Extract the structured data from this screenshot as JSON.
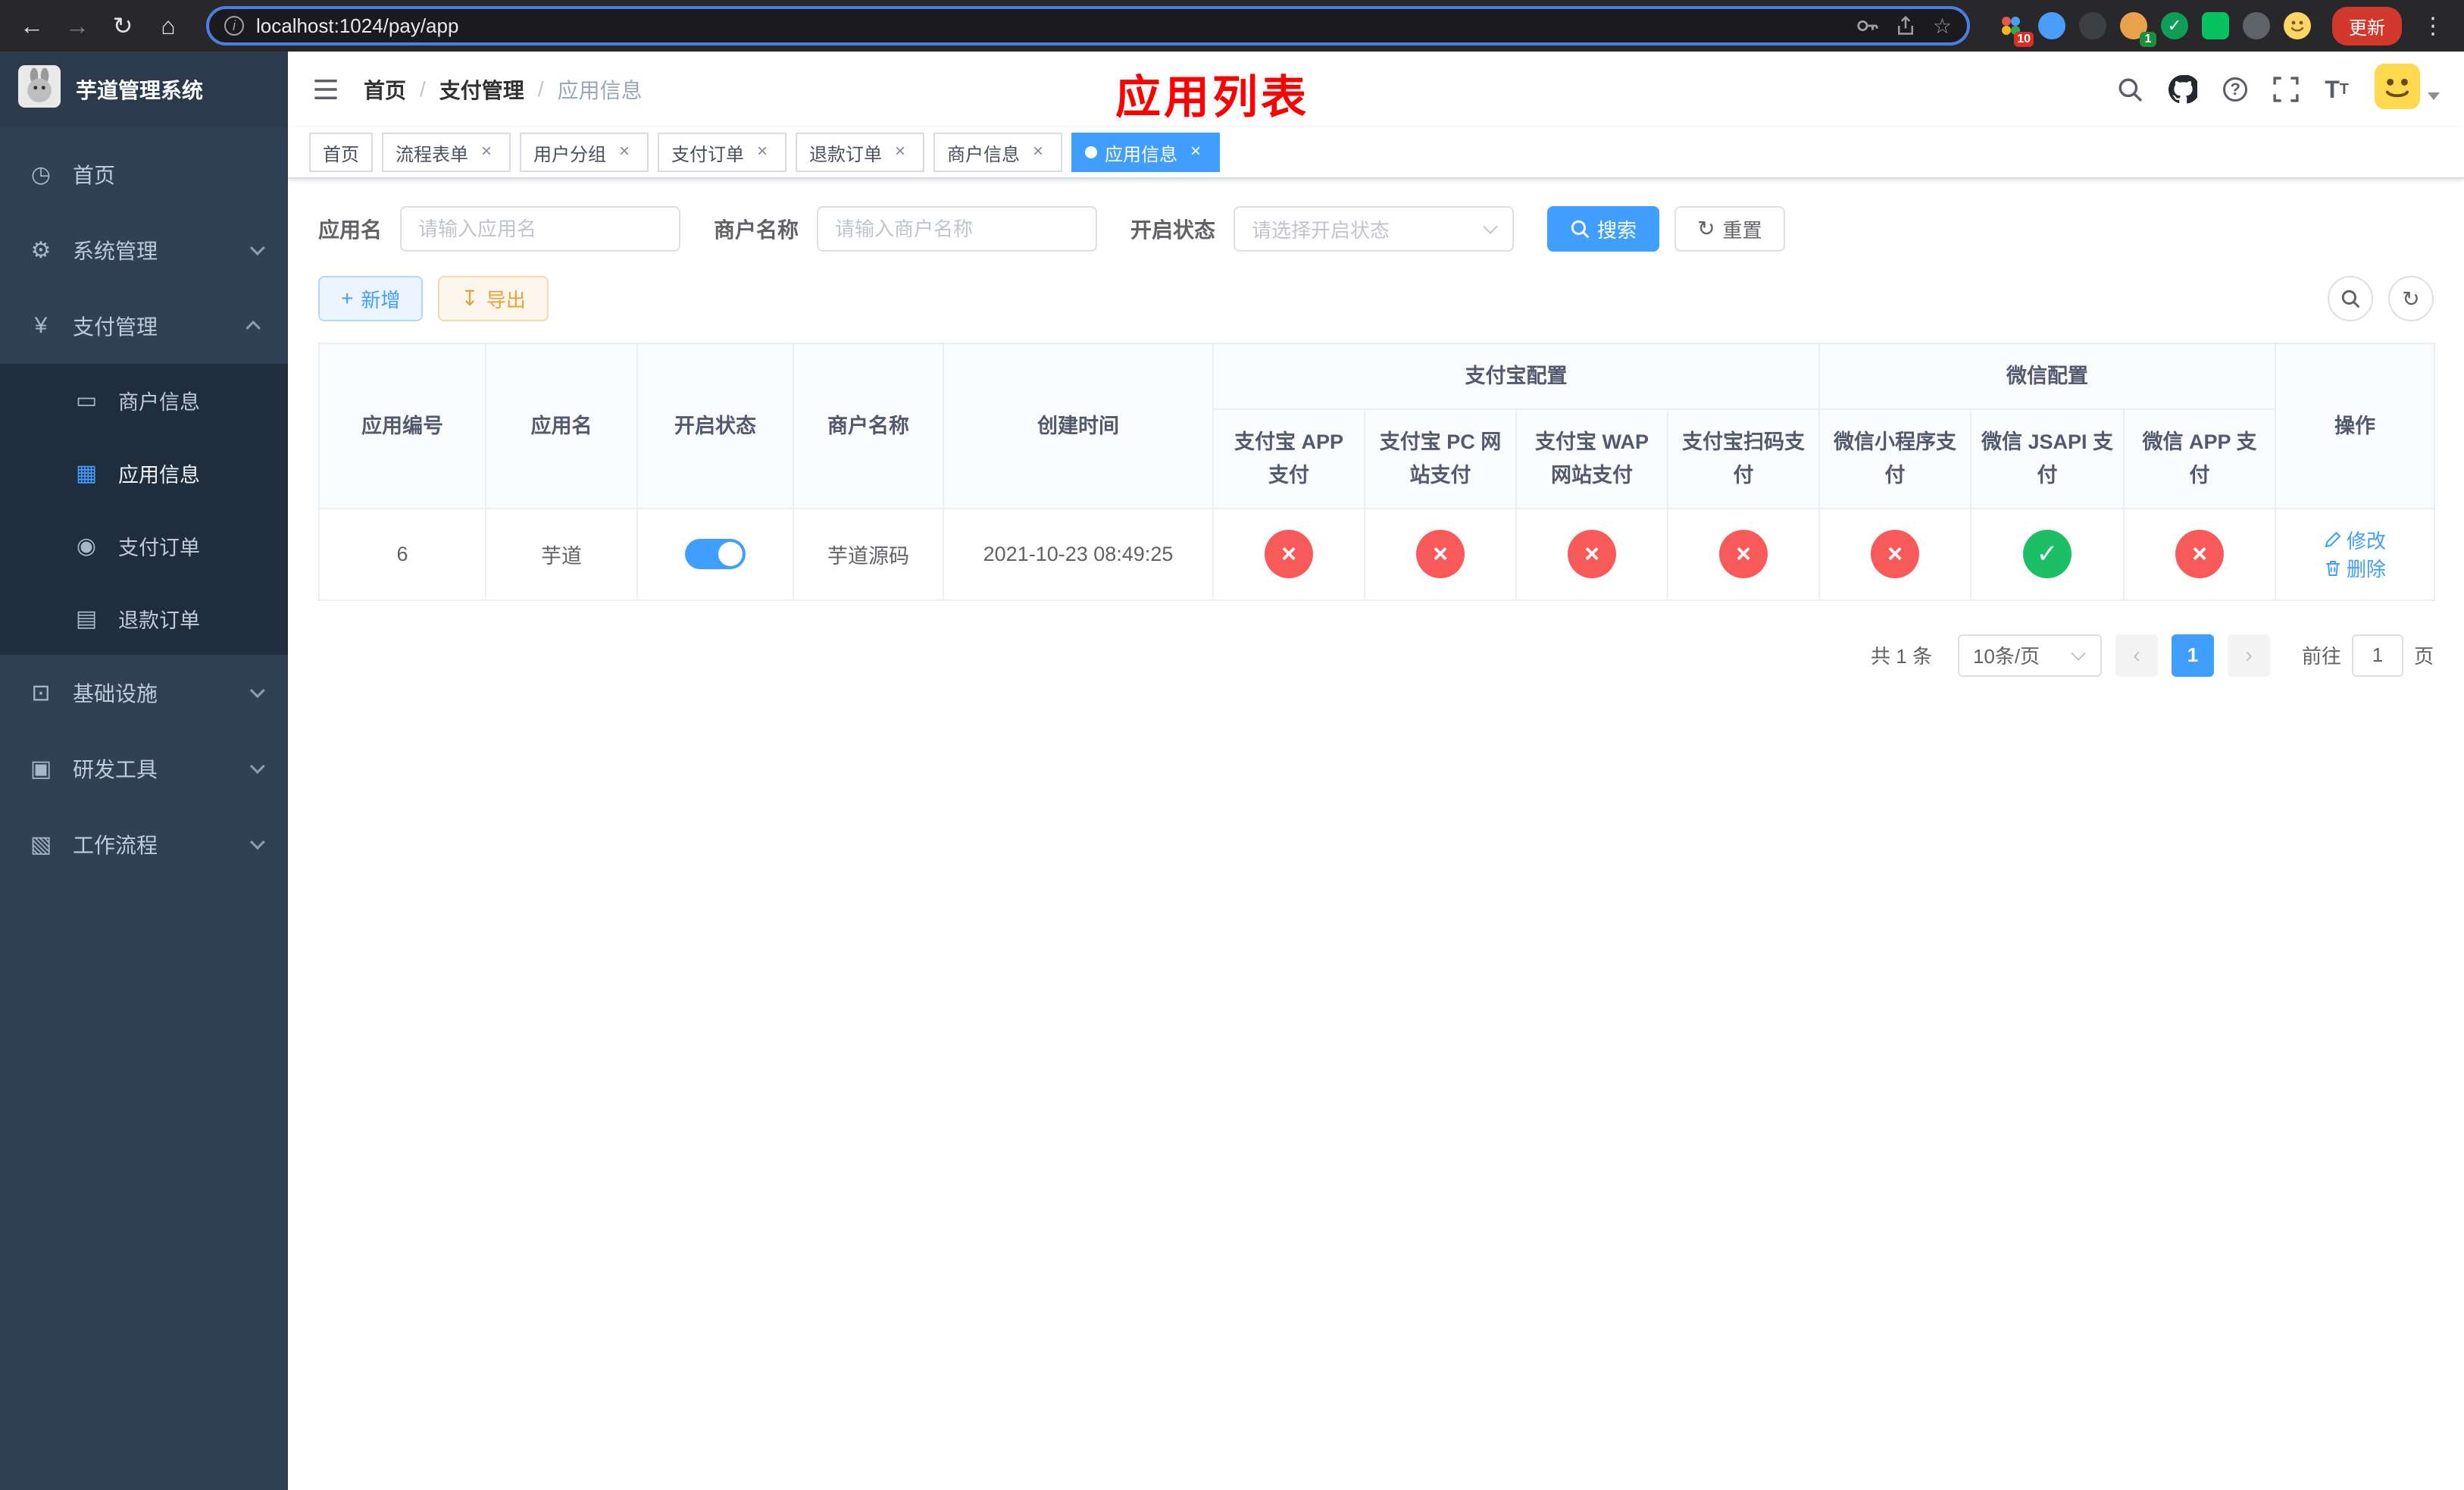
{
  "colors": {
    "accent": "#409EFF",
    "danger_circle": "#f85a5a",
    "success_circle": "#1dbf64",
    "annotation_red": "#ff0000",
    "sidebar_bg": "#304156",
    "submenu_bg": "#1f2d3d",
    "update_button_red": "#d3382c"
  },
  "browser": {
    "url": "localhost:1024/pay/app",
    "update_label": "更新",
    "ext_badge_1": "10",
    "ext_badge_2": "1"
  },
  "sidebar": {
    "logo_title": "芋道管理系统",
    "items": [
      {
        "label": "首页"
      },
      {
        "label": "系统管理"
      },
      {
        "label": "支付管理"
      },
      {
        "label": "基础设施"
      },
      {
        "label": "研发工具"
      },
      {
        "label": "工作流程"
      }
    ],
    "submenu": [
      {
        "label": "商户信息"
      },
      {
        "label": "应用信息"
      },
      {
        "label": "支付订单"
      },
      {
        "label": "退款订单"
      }
    ]
  },
  "header": {
    "breadcrumb": [
      "首页",
      "支付管理",
      "应用信息"
    ],
    "annotation": "应用列表"
  },
  "tabs": [
    {
      "label": "首页"
    },
    {
      "label": "流程表单"
    },
    {
      "label": "用户分组"
    },
    {
      "label": "支付订单"
    },
    {
      "label": "退款订单"
    },
    {
      "label": "商户信息"
    },
    {
      "label": "应用信息"
    }
  ],
  "filters": {
    "app_name_label": "应用名",
    "app_name_placeholder": "请输入应用名",
    "merchant_label": "商户名称",
    "merchant_placeholder": "请输入商户名称",
    "status_label": "开启状态",
    "status_placeholder": "请选择开启状态",
    "search_label": "搜索",
    "reset_label": "重置"
  },
  "toolbar": {
    "add_label": "新增",
    "export_label": "导出"
  },
  "table": {
    "col_app_id": "应用编号",
    "col_app_name": "应用名",
    "col_status": "开启状态",
    "col_merchant": "商户名称",
    "col_created": "创建时间",
    "group_alipay": "支付宝配置",
    "group_wechat": "微信配置",
    "col_alipay_app": "支付宝 APP 支付",
    "col_alipay_pc": "支付宝 PC 网站支付",
    "col_alipay_wap": "支付宝 WAP 网站支付",
    "col_alipay_qr": "支付宝扫码支付",
    "col_wechat_mini": "微信小程序支付",
    "col_wechat_jsapi": "微信 JSAPI 支付",
    "col_wechat_app": "微信 APP 支付",
    "col_actions": "操作",
    "rows": [
      {
        "app_id": "6",
        "app_name": "芋道",
        "enabled": true,
        "merchant": "芋道源码",
        "created": "2021-10-23 08:49:25",
        "alipay_app": false,
        "alipay_pc": false,
        "alipay_wap": false,
        "alipay_qr": false,
        "wechat_mini": false,
        "wechat_jsapi": true,
        "wechat_app": false,
        "edit_label": "修改",
        "delete_label": "删除"
      }
    ]
  },
  "pagination": {
    "total_label": "共 1 条",
    "page_size_label": "10条/页",
    "current_page": "1",
    "goto_label": "前往",
    "goto_value": "1",
    "goto_suffix_label": "页"
  }
}
